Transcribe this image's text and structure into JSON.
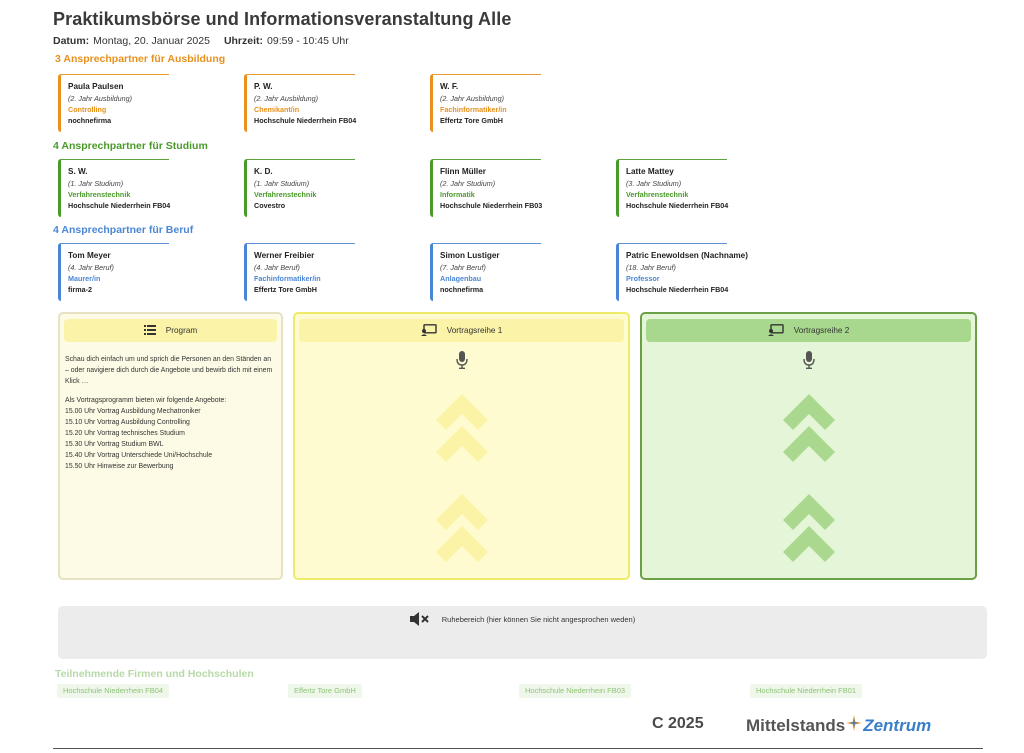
{
  "header": {
    "title": "Praktikumsbörse und Informationsveranstaltung Alle",
    "date_label": "Datum:",
    "date_value": "Montag, 20. Januar 2025",
    "time_label": "Uhrzeit:",
    "time_value": "09:59 - 10:45 Uhr"
  },
  "sections": {
    "ausbildung": {
      "title": "3 Ansprechpartner für Ausbildung",
      "contacts": [
        {
          "name": "Paula Paulsen",
          "year": "(2. Jahr Ausbildung)",
          "field": "Controlling",
          "org": "nochnefirma"
        },
        {
          "name": "P. W.",
          "year": "(2. Jahr Ausbildung)",
          "field": "Chemikant/in",
          "org": "Hochschule Niederrhein FB04"
        },
        {
          "name": "W. F.",
          "year": "(2. Jahr Ausbildung)",
          "field": "Fachinformatiker/in",
          "org": "Effertz Tore GmbH"
        }
      ]
    },
    "studium": {
      "title": "4 Ansprechpartner für Studium",
      "contacts": [
        {
          "name": "S. W.",
          "year": "(1. Jahr Studium)",
          "field": "Verfahrenstechnik",
          "org": "Hochschule Niederrhein FB04"
        },
        {
          "name": "K. D.",
          "year": "(1. Jahr Studium)",
          "field": "Verfahrenstechnik",
          "org": "Covestro"
        },
        {
          "name": "Flinn Müller",
          "year": "(2. Jahr Studium)",
          "field": "Informatik",
          "org": "Hochschule Niederrhein FB03"
        },
        {
          "name": "Latte Mattey",
          "year": "(3. Jahr Studium)",
          "field": "Verfahrenstechnik",
          "org": "Hochschule Niederrhein FB04"
        }
      ]
    },
    "beruf": {
      "title": "4 Ansprechpartner für Beruf",
      "contacts": [
        {
          "name": "Tom Meyer",
          "year": "(4. Jahr Beruf)",
          "field": "Maurer/in",
          "org": "firma-2"
        },
        {
          "name": "Werner Freibier",
          "year": "(4. Jahr Beruf)",
          "field": "Fachinformatiker/in",
          "org": "Effertz Tore GmbH"
        },
        {
          "name": "Simon Lustiger",
          "year": "(7. Jahr Beruf)",
          "field": "Anlagenbau",
          "org": "nochnefirma"
        },
        {
          "name": "Patric Enewoldsen (Nachname)",
          "year": "(18. Jahr Beruf)",
          "field": "Professor",
          "org": "Hochschule Niederrhein FB04"
        }
      ]
    }
  },
  "program": {
    "label": "Program",
    "intro": "Schau dich einfach um und sprich die Personen an den Ständen an – oder navigiere dich durch die Angebote und bewirb dich mit einem Klick …",
    "list_intro": "Als Vortragsprogramm bieten wir folgende Angebote:",
    "items": [
      "15.00 Uhr Vortrag Ausbildung Mechatroniker",
      "15.10 Uhr Vortrag Ausbildung Controlling",
      "15.20 Uhr Vortrag technisches Studium",
      "15.30 Uhr Vortrag Studium BWL",
      "15.40 Uhr Vortrag Unterschiede Uni/Hochschule",
      "15.50 Uhr Hinweise zur Bewerbung"
    ]
  },
  "vortrag1": {
    "label": "Vortragsreihe 1"
  },
  "vortrag2": {
    "label": "Vortragsreihe 2"
  },
  "rest_area": {
    "label": "Ruhebereich (hier können Sie nicht angesprochen weden)"
  },
  "firms": {
    "title": "Teilnehmende Firmen und Hochschulen",
    "items": [
      "Hochschule Niederrhein FB04",
      "Effertz Tore GmbH",
      "Hochschule Niederrhein FB03",
      "Hochschule Niederrhein FB01"
    ]
  },
  "footer": {
    "copyright": "C 2025",
    "logo_part1": "Mittelstands",
    "logo_part2": "Zentrum"
  },
  "colors": {
    "ausbildung": "#e8911e",
    "studium": "#4a9a2a",
    "beruf": "#4b86d6",
    "vortrag1_bg": "#fffbd0",
    "vortrag2_bg": "#e5f6d8"
  },
  "icons": {
    "program": "list-icon",
    "vortrag": "presentation-icon",
    "mic": "microphone-icon",
    "arrows": "double-chevron-up-icon",
    "rest": "muted-speaker-icon",
    "logo_star": "star-icon"
  }
}
